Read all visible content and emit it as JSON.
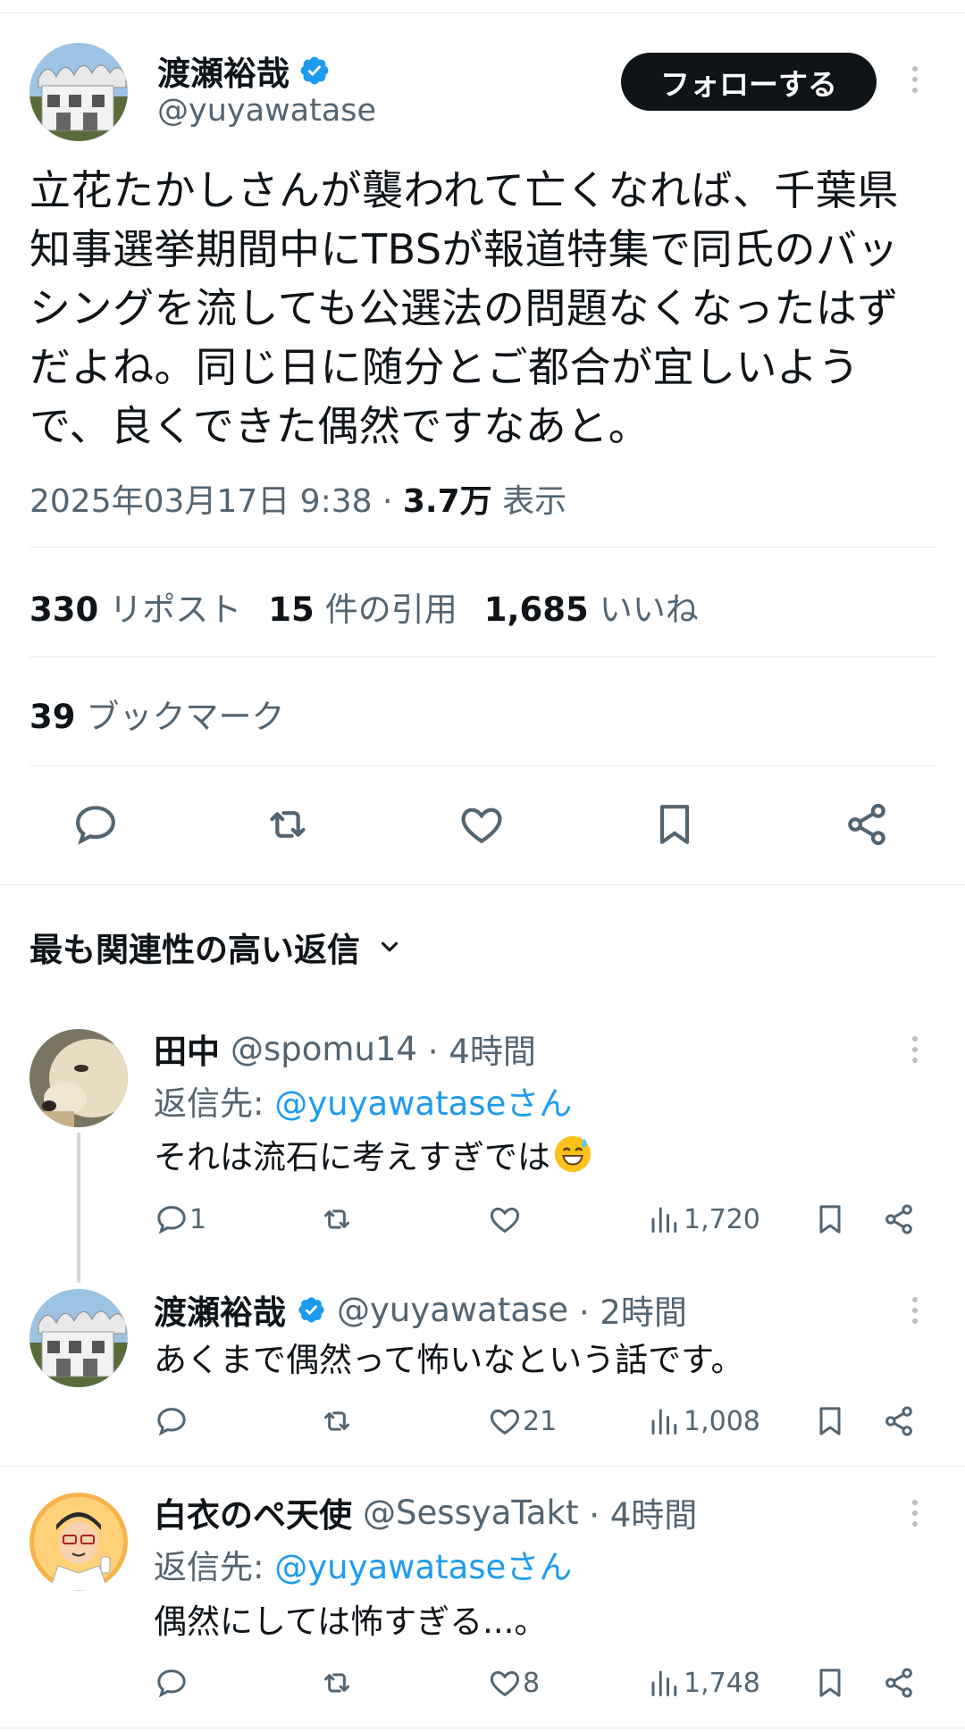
{
  "main_tweet": {
    "author_name": "渡瀬裕哉",
    "author_handle": "@yuyawatase",
    "follow_label": "フォローする",
    "text": "立花たかしさんが襲われて亡くなれば、千葉県知事選挙期間中にTBSが報道特集で同氏のバッシングを流しても公選法の問題なくなったはずだよね。同じ日に随分とご都合が宜しいようで、良くできた偶然ですなあと。",
    "timestamp": "2025年03月17日 9:38",
    "separator": " · ",
    "views_count": "3.7万",
    "views_label": "表示",
    "reposts_count": "330",
    "reposts_label": "リポスト",
    "quotes_count": "15",
    "quotes_label": "件の引用",
    "likes_count": "1,685",
    "likes_label": "いいね",
    "bookmarks_count": "39",
    "bookmarks_label": "ブックマーク"
  },
  "replies_sort_label": "最も関連性の高い返信",
  "replies": [
    {
      "name": "田中",
      "handle": "@spomu14",
      "time": "· 4時間",
      "reply_to_label": "返信先: ",
      "reply_to_handle": "@yuyawataseさん",
      "text": "それは流石に考えすぎでは",
      "replies_count": "1",
      "likes_count": "",
      "views_count": "1,720"
    },
    {
      "name": "渡瀬裕哉",
      "handle": "@yuyawatase",
      "time": "· 2時間",
      "text": "あくまで偶然って怖いなという話です。",
      "replies_count": "",
      "likes_count": "21",
      "views_count": "1,008"
    },
    {
      "name": "白衣のペ天使",
      "handle": "@SessyaTakt",
      "time": "· 4時間",
      "reply_to_label": "返信先: ",
      "reply_to_handle": "@yuyawataseさん",
      "text": "偶然にしては怖すぎる...。",
      "replies_count": "",
      "likes_count": "8",
      "views_count": "1,748"
    }
  ],
  "colors": {
    "link": "#1d9bf0",
    "secondary_text": "#536471",
    "primary_text": "#0f1419",
    "divider": "#e6ecf0"
  },
  "icons": [
    "verified-badge-icon",
    "reply-icon",
    "retweet-icon",
    "like-icon",
    "bookmark-icon",
    "share-icon",
    "views-icon",
    "more-icon",
    "chevron-down-icon",
    "sweat-smile-emoji-icon"
  ]
}
